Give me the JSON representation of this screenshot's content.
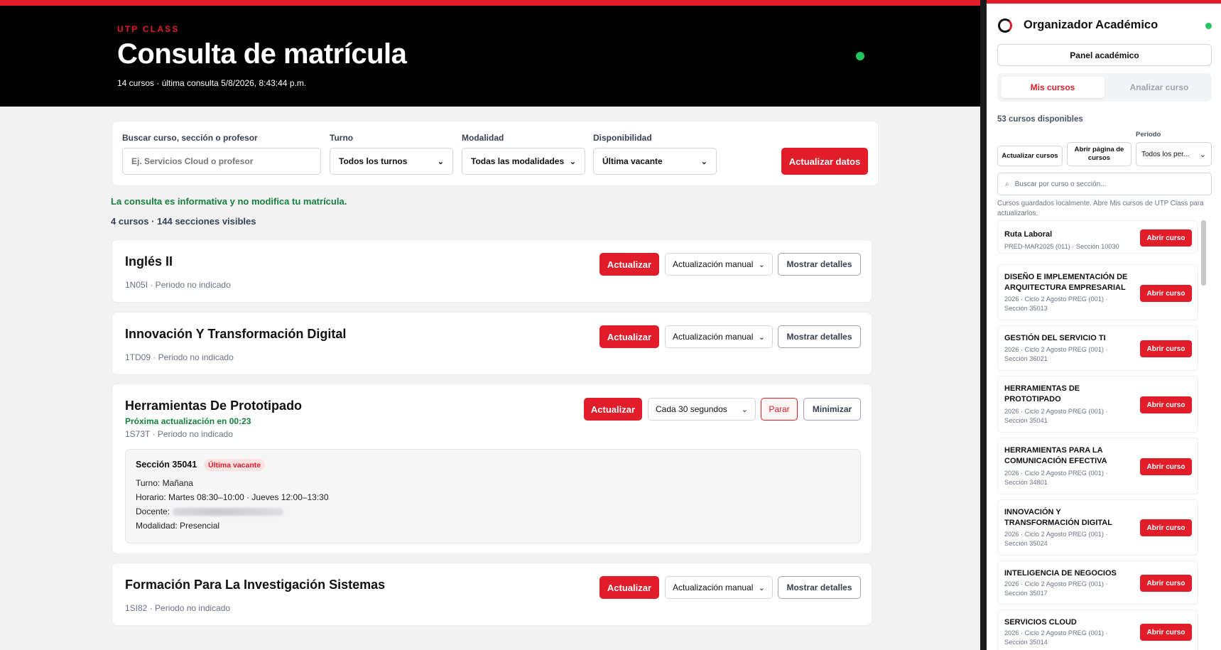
{
  "header": {
    "brand": "UTP CLASS",
    "title": "Consulta de matrícula",
    "subtitle": "14 cursos · última consulta 5/8/2026, 8:43:44 p.m."
  },
  "filters": {
    "search_label": "Buscar curso, sección o profesor",
    "search_placeholder": "Ej. Servicios Cloud o profesor",
    "turno_label": "Turno",
    "turno_value": "Todos los turnos",
    "modalidad_label": "Modalidad",
    "modalidad_value": "Todas las modalidades",
    "disponibilidad_label": "Disponibilidad",
    "disponibilidad_value": "Última vacante",
    "refresh_label": "Actualizar datos"
  },
  "info_note": "La consulta es informativa y no modifica tu matrícula.",
  "summary": "4 cursos · 144 secciones visibles",
  "courses": [
    {
      "title": "Inglés II",
      "meta": "1N05I · Periodo no indicado",
      "update_label": "Actualizar",
      "mode": "Actualización manual",
      "toggle_label": "Mostrar detalles"
    },
    {
      "title": "Innovación Y Transformación Digital",
      "meta": "1TD09 · Periodo no indicado",
      "update_label": "Actualizar",
      "mode": "Actualización manual",
      "toggle_label": "Mostrar detalles"
    },
    {
      "title": "Herramientas De Prototipado",
      "next_update": "Próxima actualización en 00:23",
      "meta": "1S73T · Periodo no indicado",
      "update_label": "Actualizar",
      "mode": "Cada 30 segundos",
      "stop_label": "Parar",
      "toggle_label": "Minimizar",
      "section": {
        "title": "Sección 35041",
        "badge": "Última vacante",
        "turno": "Turno: Mañana",
        "horario": "Horario: Martes 08:30–10:00 · Jueves 12:00–13:30",
        "docente_label": "Docente:",
        "modalidad": "Modalidad: Presencial"
      }
    },
    {
      "title": "Formación Para La Investigación Sistemas",
      "meta": "1SI82 · Periodo no indicado",
      "update_label": "Actualizar",
      "mode": "Actualización manual",
      "toggle_label": "Mostrar detalles"
    }
  ],
  "sidebar": {
    "title": "Organizador Académico",
    "panel_button": "Panel académico",
    "tabs": [
      "Mis cursos",
      "Analizar curso"
    ],
    "available": "53 cursos disponibles",
    "refresh_courses": "Actualizar cursos",
    "open_page": "Abrir página de cursos",
    "period_label": "Periodo",
    "period_value": "Todos los per...",
    "search_placeholder": "Buscar por curso o sección...",
    "note": "Cursos guardados localmente. Abre Mis cursos de UTP Class para actualizarlos.",
    "open_label": "Abrir curso",
    "items": [
      {
        "name": "Ruta Laboral",
        "meta": "PRED-MAR2025 (011) · Sección 10030"
      },
      {
        "name": "DISEÑO E IMPLEMENTACIÓN DE ARQUITECTURA EMPRESARIAL",
        "meta": "2026 · Ciclo 2 Agosto PREG (001) · Sección 35013"
      },
      {
        "name": "GESTIÓN DEL SERVICIO TI",
        "meta": "2026 · Ciclo 2 Agosto PREG (001) · Sección 36021"
      },
      {
        "name": "HERRAMIENTAS DE PROTOTIPADO",
        "meta": "2026 · Ciclo 2 Agosto PREG (001) · Sección 35041"
      },
      {
        "name": "HERRAMIENTAS PARA LA COMUNICACIÓN EFECTIVA",
        "meta": "2026 · Ciclo 2 Agosto PREG (001) · Sección 34801"
      },
      {
        "name": "INNOVACIÓN Y TRANSFORMACIÓN DIGITAL",
        "meta": "2026 · Ciclo 2 Agosto PREG (001) · Sección 35024"
      },
      {
        "name": "INTELIGENCIA DE NEGOCIOS",
        "meta": "2026 · Ciclo 2 Agosto PREG (001) · Sección 35017"
      },
      {
        "name": "SERVICIOS CLOUD",
        "meta": "2026 · Ciclo 2 Agosto PREG (001) · Sección 35014"
      }
    ]
  },
  "colors": {
    "accent_red": "#e11d2a",
    "status_green": "#22c55e",
    "success_text": "#15803d"
  },
  "icons": [
    "select-chevron-icon",
    "search-icon",
    "logo-ring-icon",
    "status-dot-icon"
  ]
}
